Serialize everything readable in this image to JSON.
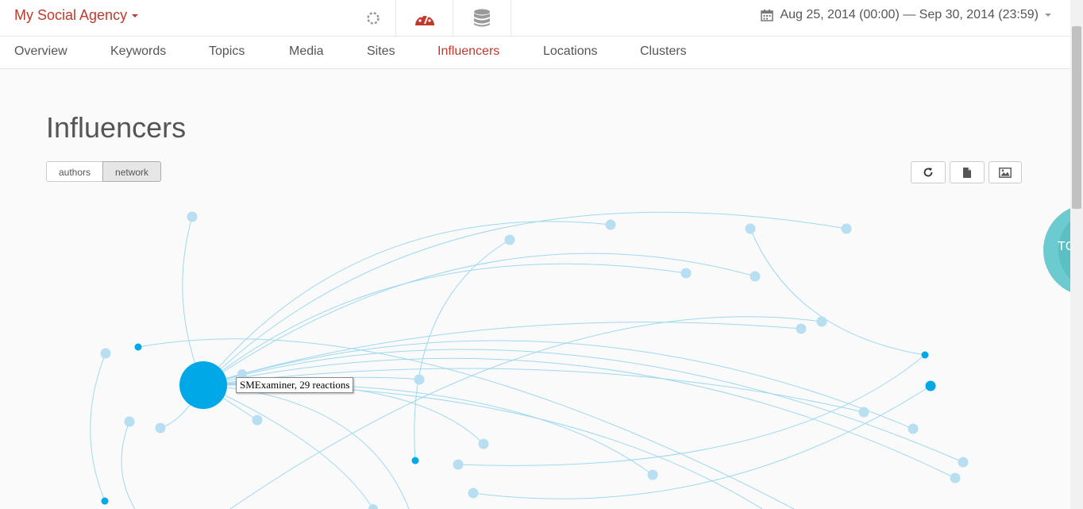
{
  "header": {
    "brand": "My Social Agency",
    "icons": [
      "loading-spinner-icon",
      "dashboard-gauge-icon",
      "database-icon"
    ],
    "date_range": "Aug 25, 2014 (00:00) — Sep 30, 2014 (23:59)"
  },
  "nav": {
    "tabs": [
      {
        "label": "Overview"
      },
      {
        "label": "Keywords"
      },
      {
        "label": "Topics"
      },
      {
        "label": "Media"
      },
      {
        "label": "Sites"
      },
      {
        "label": "Influencers"
      },
      {
        "label": "Locations"
      },
      {
        "label": "Clusters"
      }
    ],
    "active": "Influencers"
  },
  "page": {
    "title": "Influencers",
    "view_toggle": {
      "authors": "authors",
      "network": "network",
      "selected": "network"
    },
    "tools": [
      "refresh-icon",
      "document-icon",
      "image-icon"
    ]
  },
  "network": {
    "tooltip": "SMExaminer, 29 reactions",
    "partial_label": "TC"
  },
  "colors": {
    "accent": "#c0392b",
    "node_primary": "#00a8e8",
    "node_light": "#b8def2",
    "edge": "#8fd3ee",
    "cluster": "#6ccbcf"
  }
}
